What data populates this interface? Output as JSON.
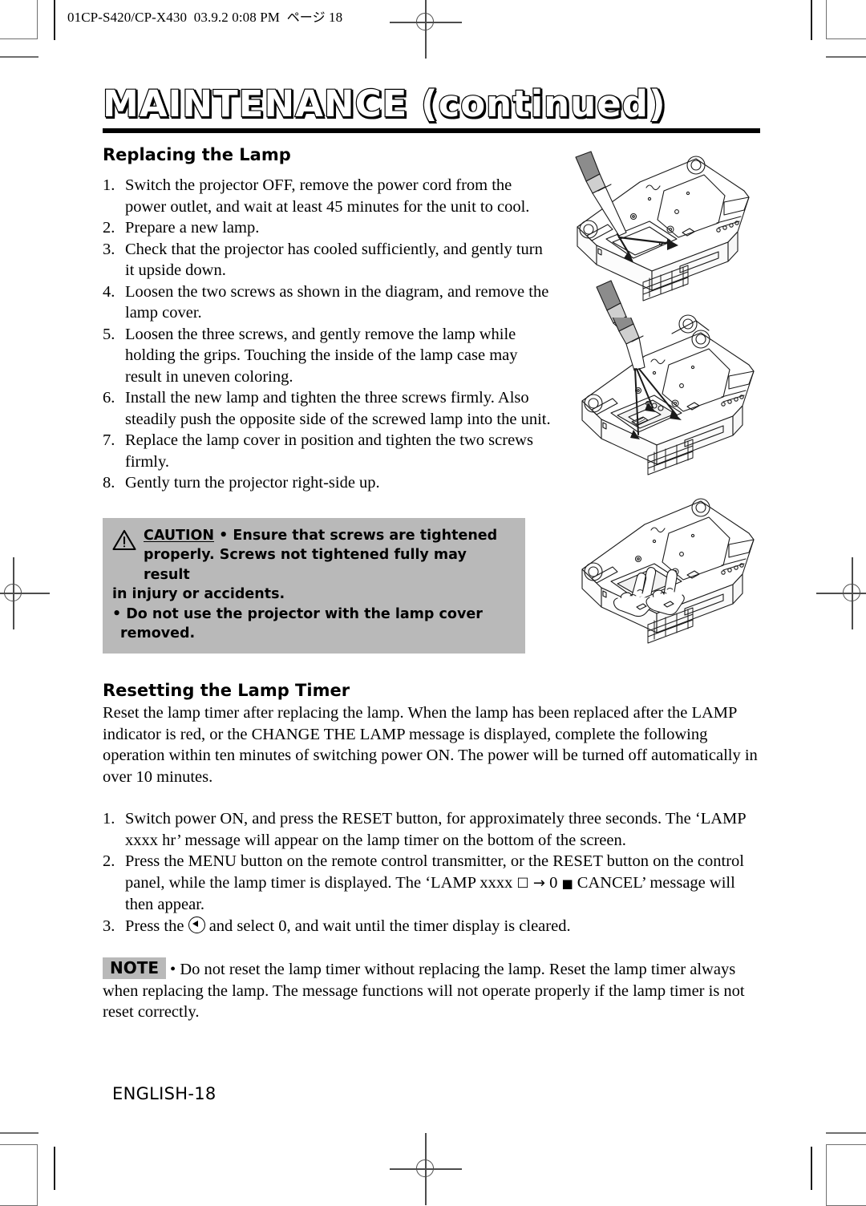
{
  "file_header": {
    "filename": "01CP-S420/CP-X430",
    "date": "03.9.2",
    "time": "0:08 PM",
    "page_label_jp": "ページ",
    "page_number": "18"
  },
  "document": {
    "title": "MAINTENANCE (continued)",
    "footer": "ENGLISH-18"
  },
  "section_replacing": {
    "heading": "Replacing the Lamp",
    "steps": [
      {
        "num": "1.",
        "text": "Switch the projector OFF, remove the power cord from the power outlet, and wait at least 45 minutes for the unit to cool."
      },
      {
        "num": "2.",
        "text": "Prepare a new lamp."
      },
      {
        "num": "3.",
        "text": "Check that the projector has cooled sufficiently, and gently turn it upside down."
      },
      {
        "num": "4.",
        "text": "Loosen the two screws as shown in the diagram, and remove the lamp cover."
      },
      {
        "num": "5.",
        "text": "Loosen the three screws, and gently remove the lamp while holding the grips. Touching the inside of the lamp case may result in uneven coloring."
      },
      {
        "num": "6.",
        "text": "Install the new lamp and tighten the three screws firmly. Also steadily push the opposite side of the screwed lamp into the unit."
      },
      {
        "num": "7.",
        "text": "Replace the lamp cover in position and tighten the  two screws firmly."
      },
      {
        "num": "8.",
        "text": "Gently turn the projector right-side up."
      }
    ]
  },
  "caution": {
    "icon": "warning-triangle-icon",
    "label": "CAUTION",
    "line1": "• Ensure that screws are tightened",
    "line2": "properly. Screws not tightened fully may result",
    "line3": "in injury or accidents.",
    "bullet2_line1": "• Do not use the projector with the lamp cover",
    "bullet2_line2": "removed.",
    "background_color": "#b9b9b9"
  },
  "section_resetting": {
    "heading": "Resetting the Lamp Timer",
    "intro": "Reset the lamp timer after replacing the lamp. When the lamp has been replaced after the LAMP indicator is red, or the CHANGE THE LAMP message is displayed, complete the following operation within ten minutes of switching power ON. The power will be turned off automatically in over 10 minutes.",
    "steps": [
      {
        "num": "1.",
        "text": "Switch power ON, and press the RESET button, for approximately three seconds. The ‘LAMP xxxx hr’ message will appear on the lamp timer on the bottom of the screen."
      },
      {
        "num": "2.",
        "part_a": "Press the MENU button on the remote control transmitter, or the RESET button on the control panel, while the lamp timer is displayed. The ‘LAMP xxxx ",
        "symbol_square": "☐",
        "symbol_arrow": "→",
        "part_b": " 0 ",
        "symbol_filled": "■",
        "part_c": " CANCEL’ message will then appear."
      },
      {
        "num": "3.",
        "part_a": "Press the ",
        "button_icon": "left-arrow-button-icon",
        "part_b": " and select 0, and wait until the timer display is cleared."
      }
    ]
  },
  "note": {
    "tag": "NOTE",
    "text": "• Do not reset the lamp timer without replacing the lamp. Reset the lamp timer always when replacing the lamp. The message functions will not operate  properly if the lamp timer is not reset correctly.",
    "background_color": "#b9b9b9"
  },
  "illustrations": [
    {
      "name": "projector-underside-screwdriver-lamp-cover-screws"
    },
    {
      "name": "projector-underside-screwdriver-lamp-screws"
    },
    {
      "name": "projector-underside-hands-removing-lamp"
    }
  ]
}
